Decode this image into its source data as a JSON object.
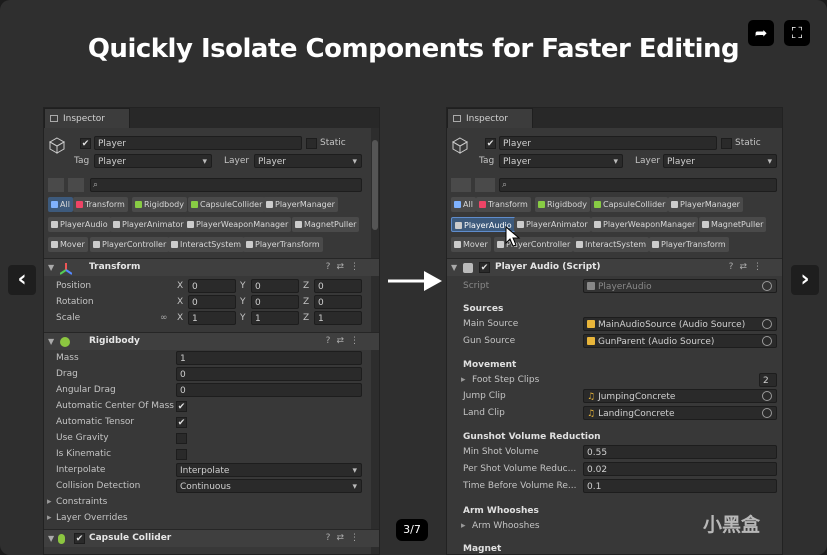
{
  "headline": "Quickly Isolate Components for Faster Editing",
  "slide_counter": "3/7",
  "watermark": "小黑盒",
  "nav": {
    "prev": "‹",
    "next": "›"
  },
  "left": {
    "tab": "Inspector",
    "object_name": "Player",
    "static_label": "Static",
    "tag_label": "Tag",
    "tag_value": "Player",
    "layer_label": "Layer",
    "layer_value": "Player",
    "filters": [
      "All",
      "Transform",
      "Rigidbody",
      "CapsuleCollider",
      "PlayerManager",
      "PlayerAudio",
      "PlayerAnimator",
      "PlayerWeaponManager",
      "MagnetPuller",
      "Mover",
      "PlayerController",
      "InteractSystem",
      "PlayerTransform"
    ],
    "transform": {
      "title": "Transform",
      "rows": [
        {
          "label": "Position",
          "x": "0",
          "y": "0",
          "z": "0"
        },
        {
          "label": "Rotation",
          "x": "0",
          "y": "0",
          "z": "0"
        },
        {
          "label": "Scale",
          "x": "1",
          "y": "1",
          "z": "1"
        }
      ]
    },
    "rigidbody": {
      "title": "Rigidbody",
      "mass_label": "Mass",
      "mass": "1",
      "drag_label": "Drag",
      "drag": "0",
      "angular_label": "Angular Drag",
      "angular": "0",
      "acm_label": "Automatic Center Of Mass",
      "at_label": "Automatic Tensor",
      "gravity_label": "Use Gravity",
      "kin_label": "Is Kinematic",
      "interp_label": "Interpolate",
      "interp": "Interpolate",
      "coll_label": "Collision Detection",
      "coll": "Continuous",
      "constraints": "Constraints",
      "overrides": "Layer Overrides"
    },
    "capsule_title": "Capsule Collider"
  },
  "right": {
    "tab": "Inspector",
    "object_name": "Player",
    "static_label": "Static",
    "tag_label": "Tag",
    "tag_value": "Player",
    "layer_label": "Layer",
    "layer_value": "Player",
    "filters": [
      "All",
      "Transform",
      "Rigidbody",
      "CapsuleCollider",
      "PlayerManager",
      "PlayerAudio",
      "PlayerAnimator",
      "PlayerWeaponManager",
      "MagnetPuller",
      "Mover",
      "PlayerController",
      "InteractSystem",
      "PlayerTransform"
    ],
    "component_title": "Player Audio (Script)",
    "script_label": "Script",
    "script_value": "PlayerAudio",
    "sources_head": "Sources",
    "main_label": "Main Source",
    "main_value": "MainAudioSource (Audio Source)",
    "gun_label": "Gun Source",
    "gun_value": "GunParent (Audio Source)",
    "movement_head": "Movement",
    "foot_label": "Foot Step Clips",
    "foot_count": "2",
    "jump_label": "Jump Clip",
    "jump_value": "JumpingConcrete",
    "land_label": "Land Clip",
    "land_value": "LandingConcrete",
    "gunshot_head": "Gunshot Volume Reduction",
    "min_label": "Min Shot Volume",
    "min_value": "0.55",
    "per_label": "Per Shot Volume Reduc...",
    "per_value": "0.02",
    "time_label": "Time Before Volume Re...",
    "time_value": "0.1",
    "arm_head": "Arm Whooshes",
    "arm_label": "Arm Whooshes",
    "magnet_head": "Magnet"
  }
}
